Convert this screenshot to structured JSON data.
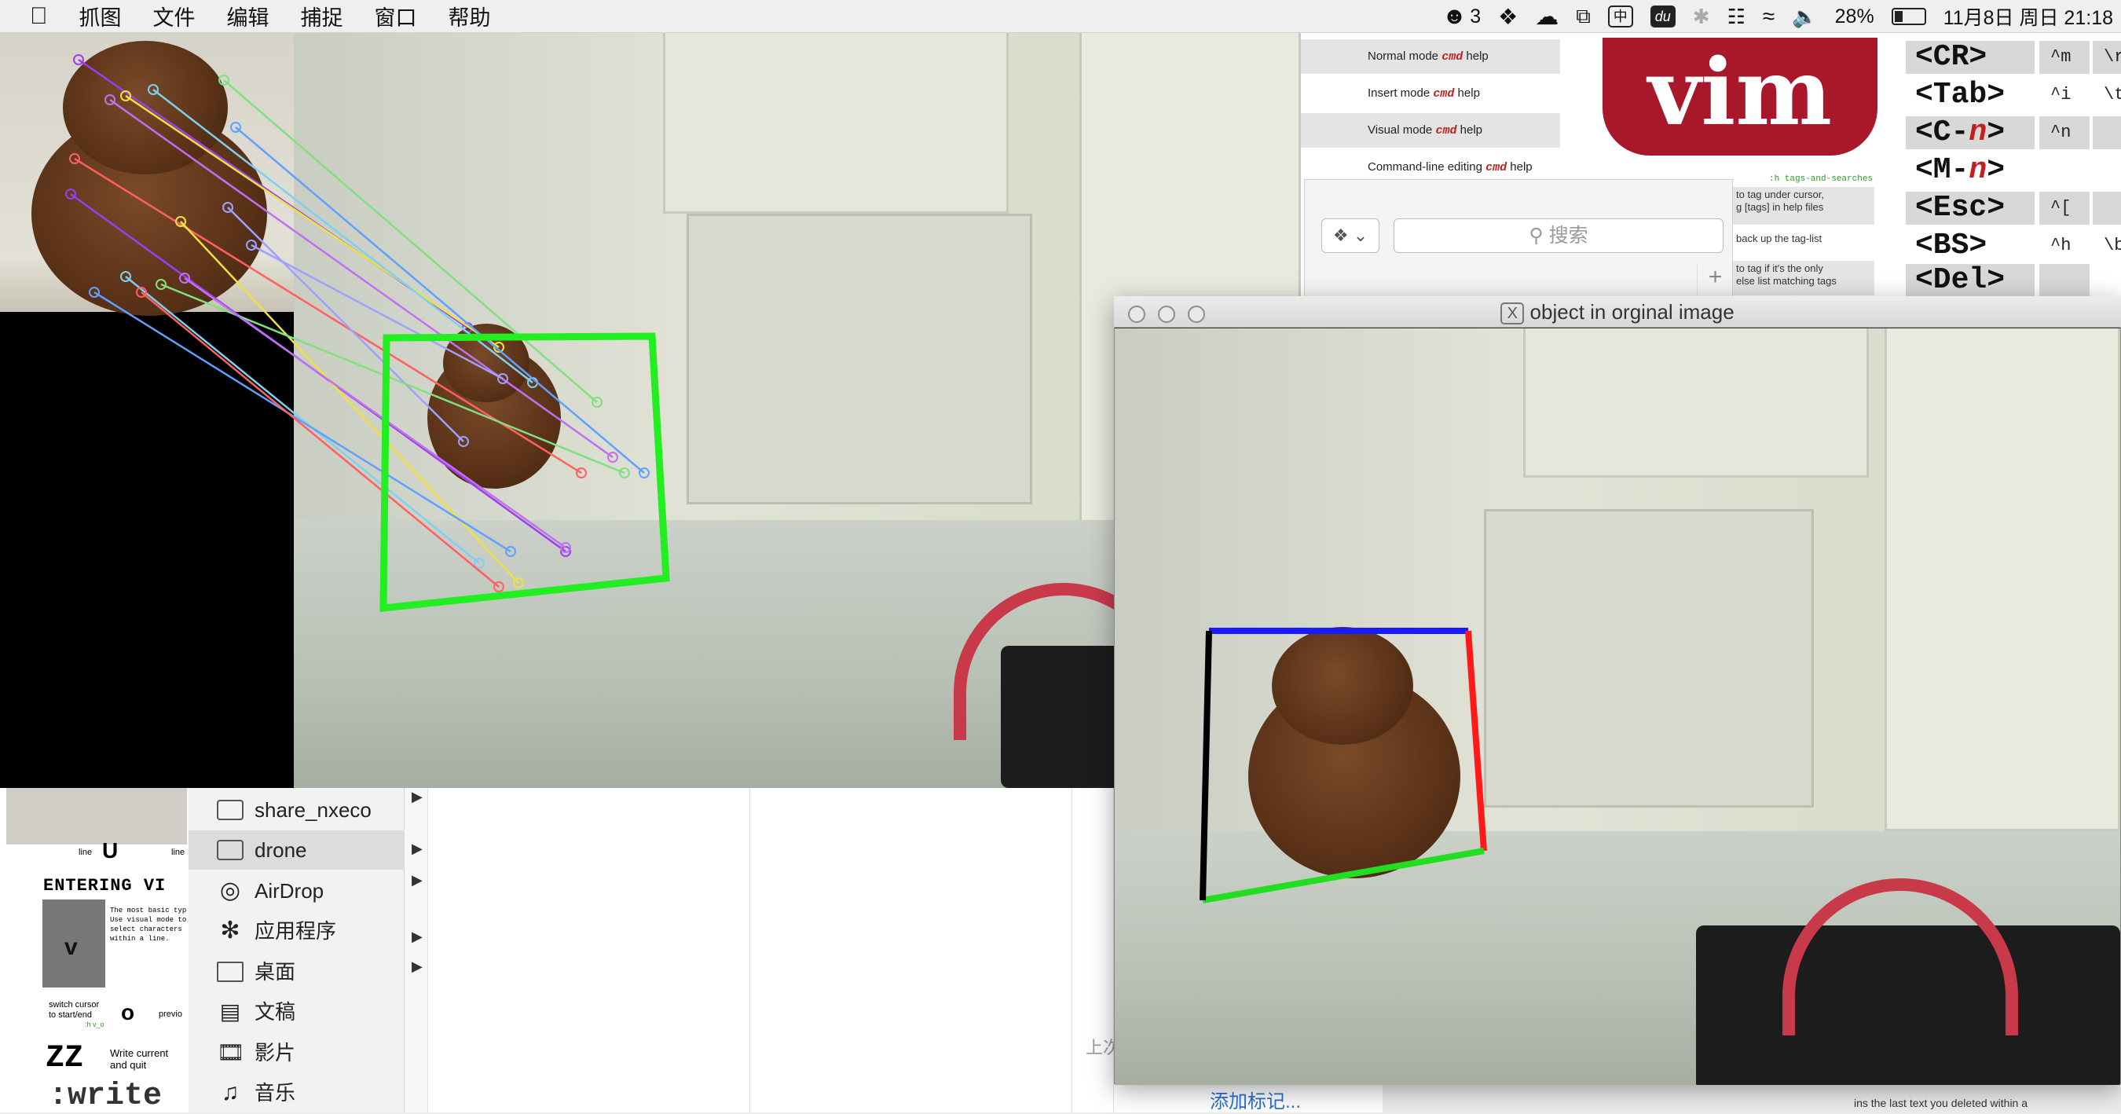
{
  "menubar": {
    "apple": "",
    "items": [
      "抓图",
      "文件",
      "编辑",
      "捕捉",
      "窗口",
      "帮助"
    ],
    "wechat_count": "3",
    "battery": "28%",
    "datetime": "11月8日 周日  21:18",
    "du_icon": "du",
    "zh_icon": "中"
  },
  "vim_sheet": {
    "modes": [
      {
        "prefix": "Normal mode ",
        "cmd": "cmd",
        "suffix": " help"
      },
      {
        "prefix": "Insert mode ",
        "cmd": "cmd",
        "suffix": " help"
      },
      {
        "prefix": "Visual mode ",
        "cmd": "cmd",
        "suffix": " help"
      },
      {
        "prefix": "Command-line editing ",
        "cmd": "cmd",
        "suffix": " help"
      }
    ],
    "logo": "vim",
    "keys": [
      {
        "key": "<CR>",
        "ctl": "^m",
        "esc": "\\r"
      },
      {
        "key": "<Tab>",
        "ctl": "^i",
        "esc": "\\t"
      },
      {
        "key_pre": "<C-",
        "key_n": "n",
        "key_post": ">",
        "ctl": "^n",
        "esc": ""
      },
      {
        "key_pre": "<M-",
        "key_n": "n",
        "key_post": ">",
        "ctl": "",
        "esc": ""
      },
      {
        "key": "<Esc>",
        "ctl": "^[",
        "esc": ""
      },
      {
        "key": "<BS>",
        "ctl": "^h",
        "esc": "\\b"
      },
      {
        "key": "<Del>",
        "ctl": "",
        "esc": ""
      }
    ],
    "tags_heading": ":h tags-and-searches",
    "tag_notes": [
      "to tag under cursor,\ng [tags] in help files",
      "back up the tag-list",
      "to tag if it's the only\nelse list matching tags"
    ]
  },
  "search_panel": {
    "placeholder": "搜索",
    "dropbox_label": "⌄",
    "plus": "+"
  },
  "left_vim": {
    "line_labels": [
      "line",
      "line"
    ],
    "big_letter": "U",
    "section_title": "ENTERING VI",
    "v_key": "v",
    "visual_text": "The most basic typ\nUse visual mode to\nselect characters\nwithin a line.",
    "switch_text": "switch cursor\nto start/end",
    "switch_help": ":h v_o",
    "o_key": "o",
    "prev_text": "previo",
    "zz_key": "ZZ",
    "zz_text": "Write current\nand quit",
    "write_cmd": ":write"
  },
  "finder": {
    "sidebar": [
      {
        "label": "share_nxeco",
        "icon": "folder-icon"
      },
      {
        "label": "drone",
        "icon": "folder-icon",
        "selected": true
      },
      {
        "label": "AirDrop",
        "icon": "airdrop-icon"
      },
      {
        "label": "应用程序",
        "icon": "applications-icon"
      },
      {
        "label": "桌面",
        "icon": "desktop-icon"
      },
      {
        "label": "文稿",
        "icon": "documents-icon"
      },
      {
        "label": "影片",
        "icon": "movies-icon"
      },
      {
        "label": "音乐",
        "icon": "music-icon"
      }
    ],
    "last_opened_prefix": "上次",
    "add_tag": "添加标记...",
    "footer_text": "ins the last text you deleted within a"
  },
  "object_window": {
    "title": "object in orginal image",
    "x_icon": "X"
  },
  "colors": {
    "vim_red": "#a8182a",
    "bbox_green": "#22ee22",
    "match_lines": [
      "#9a3ef0",
      "#f0e040",
      "#7fd0f0",
      "#80e080",
      "#c070f0",
      "#60a0ff",
      "#ff6060",
      "#a0a0ff"
    ],
    "edge_blue": "#1a1aff",
    "edge_red": "#ff1a1a",
    "edge_black": "#000000",
    "edge_green": "#22dd22"
  }
}
